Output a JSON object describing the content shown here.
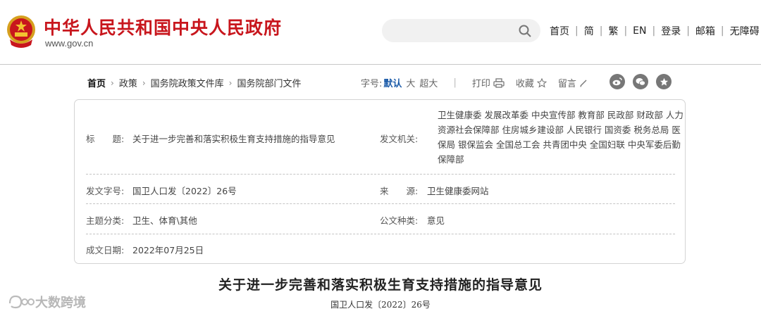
{
  "header": {
    "site_title": "中华人民共和国中央人民政府",
    "site_url": "www.gov.cn",
    "search_placeholder": "",
    "nav": [
      "首页",
      "简",
      "繁",
      "EN",
      "登录",
      "邮箱",
      "无障碍"
    ]
  },
  "breadcrumb": {
    "items": [
      "首页",
      "政策",
      "国务院政策文件库",
      "国务院部门文件"
    ]
  },
  "tools": {
    "font_size_label": "字号:",
    "font_default": "默认",
    "font_large": "大",
    "font_xlarge": "超大",
    "print": "打印",
    "favorite": "收藏",
    "comment": "留言",
    "share_icons": [
      "weibo-icon",
      "wechat-icon",
      "star-icon"
    ]
  },
  "info": {
    "title_label": "标　　题:",
    "title_value": "关于进一步完善和落实积极生育支持措施的指导意见",
    "issuer_label": "发文机关:",
    "issuer_value": "卫生健康委 发展改革委 中央宣传部 教育部 民政部 财政部 人力资源社会保障部 住房城乡建设部 人民银行 国资委 税务总局 医保局 银保监会 全国总工会 共青团中央 全国妇联 中央军委后勤保障部",
    "docno_label": "发文字号:",
    "docno_value": "国卫人口发〔2022〕26号",
    "source_label": "来　　源:",
    "source_value": "卫生健康委网站",
    "topic_label": "主题分类:",
    "topic_value": "卫生、体育\\其他",
    "type_label": "公文种类:",
    "type_value": "意见",
    "date_label": "成文日期:",
    "date_value": "2022年07月25日"
  },
  "document": {
    "title": "关于进一步完善和落实积极生育支持措施的指导意见",
    "number": "国卫人口发〔2022〕26号"
  },
  "watermark": {
    "text": "大数跨境"
  },
  "colors": {
    "brand_red": "#c8161d",
    "link_blue": "#1a5aa8"
  }
}
